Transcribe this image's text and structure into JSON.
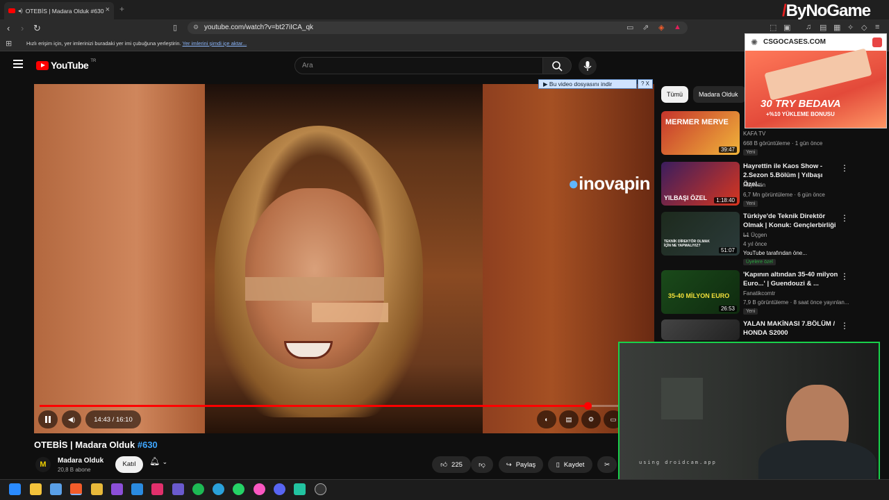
{
  "browser": {
    "tab_title": "OTEBİS | Madara Olduk #630",
    "url": "youtube.com/watch?v=bt27iICA_qk",
    "bookmarks_text": "Hızlı erişim için, yer imlerinizi buradaki yer imi çubuğuna yerleştirin.",
    "bookmarks_link": "Yer imlerini şimdi içe aktar...",
    "watermark": "ByNoGame"
  },
  "youtube": {
    "logo_text": "YouTube",
    "country": "TR",
    "search_placeholder": "Ara"
  },
  "player": {
    "overlay_brand": "inovapin",
    "download_bar": "▶ Bu video dosyasını indir",
    "download_help": "? X",
    "time": "14:43 / 16:10",
    "progress_fraction": 0.9
  },
  "video": {
    "title": "OTEBİS | Madara Olduk",
    "tag": "#630",
    "channel": "Madara Olduk",
    "subs": "20,8 B abone",
    "join": "Katıl",
    "likes": "225",
    "share": "Paylaş",
    "save": "Kaydet"
  },
  "sidebar": {
    "chips": [
      "Tümü",
      "Madara Olduk"
    ],
    "items": [
      {
        "title": "",
        "channel": "KAFA TV",
        "meta": "668 B görüntüleme · 1 gün önce",
        "badge": "Yeni",
        "duration": "39:47",
        "thumb_text": "MERMER MERVE"
      },
      {
        "title": "Hayrettin ile Kaos Show - 2.Sezon 5.Bölüm | Yılbaşı Özel...",
        "channel": "Hayrettin",
        "meta": "6,7 Mn görüntüleme · 6 gün önce",
        "badge": "Yeni",
        "duration": "1:18:40",
        "thumb_text": "YILBAŞI ÖZEL"
      },
      {
        "title": "Türkiye'de Teknik Direktör Olmak | Konuk: Gençlerbirliği ...",
        "channel": "L1 Üçgen",
        "meta": "4 yıl önce",
        "meta2": "YouTube tarafından öne...",
        "badge": "Üyelere özel",
        "duration": "51:07",
        "thumb_text": "TEKNİK DİREKTÖR OLMAK İÇİN NE YAPMALIYIZ?"
      },
      {
        "title": "'Kapının altından 35-40 milyon Euro...' | Guendouzi & ...",
        "channel": "Fanatikcomtr",
        "meta": "7,9 B görüntüleme · 8 saat önce yayınlan...",
        "badge": "Yeni",
        "duration": "26:53",
        "thumb_text": "35-40 MİLYON EURO"
      },
      {
        "title": "YALAN MAKİNASI 7.BÖLÜM / HONDA S2000",
        "channel": "",
        "meta": "",
        "badge": "",
        "duration": "",
        "thumb_text": ""
      }
    ]
  },
  "ad": {
    "brand": "CSGOCASES.COM",
    "headline": "30 TRY BEDAVA",
    "sub": "+%10 YÜKLEME BONUSU"
  },
  "webcam": {
    "label": "using droidcam.app"
  },
  "colors": {
    "accent": "#ff0000",
    "link": "#3ea6ff",
    "webcam_border": "#19d14b"
  }
}
